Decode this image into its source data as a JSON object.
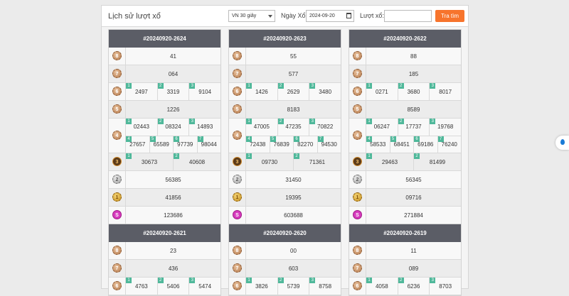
{
  "header": {
    "title": "Lịch sử lượt xổ",
    "game_select": "VN 30 giây",
    "date_label": "Ngày Xổ:",
    "date_value": "2024-09-20",
    "draw_label": "Lượt xổ:",
    "draw_placeholder": "",
    "search_button": "Tra tìm"
  },
  "cards": [
    {
      "id": "#20240920-2624",
      "p8": "41",
      "p7": "064",
      "p6": [
        "2497",
        "3319",
        "9104"
      ],
      "p5": "1226",
      "p4a": [
        "02443",
        "08324",
        "14893"
      ],
      "p4b": [
        "27657",
        "65589",
        "97739",
        "98044"
      ],
      "p3": [
        "30673",
        "40608"
      ],
      "p2": "56385",
      "p1": "41856",
      "special": "123686"
    },
    {
      "id": "#20240920-2623",
      "p8": "55",
      "p7": "577",
      "p6": [
        "1426",
        "2629",
        "3480"
      ],
      "p5": "8183",
      "p4a": [
        "47005",
        "47235",
        "70822"
      ],
      "p4b": [
        "72438",
        "76839",
        "82270",
        "94530"
      ],
      "p3": [
        "09730",
        "71361"
      ],
      "p2": "31450",
      "p1": "19395",
      "special": "603688"
    },
    {
      "id": "#20240920-2622",
      "p8": "88",
      "p7": "185",
      "p6": [
        "0271",
        "3680",
        "8017"
      ],
      "p5": "8589",
      "p4a": [
        "06247",
        "17737",
        "19768"
      ],
      "p4b": [
        "58533",
        "68451",
        "69186",
        "76240"
      ],
      "p3": [
        "29463",
        "81499"
      ],
      "p2": "56345",
      "p1": "09716",
      "special": "271884"
    },
    {
      "id": "#20240920-2621",
      "p8": "23",
      "p7": "436",
      "p6": [
        "4763",
        "5406",
        "5474"
      ]
    },
    {
      "id": "#20240920-2620",
      "p8": "00",
      "p7": "603",
      "p6": [
        "3826",
        "5739",
        "8758"
      ]
    },
    {
      "id": "#20240920-2619",
      "p8": "11",
      "p7": "089",
      "p6": [
        "4058",
        "6236",
        "8703"
      ]
    }
  ],
  "icons": {
    "p8": "8",
    "p7": "7",
    "p6": "6",
    "p5": "5",
    "p4": "4",
    "p3": "3",
    "p2": "2",
    "p1": "1",
    "special": "S"
  },
  "sub_index": [
    "1",
    "2",
    "3",
    "4",
    "5",
    "6",
    "7"
  ],
  "colors": {
    "card_header": "#5b5d66",
    "accent_button": "#f7742c",
    "index_badge": "#4fb89a",
    "special_icon": "#d63bbd"
  }
}
